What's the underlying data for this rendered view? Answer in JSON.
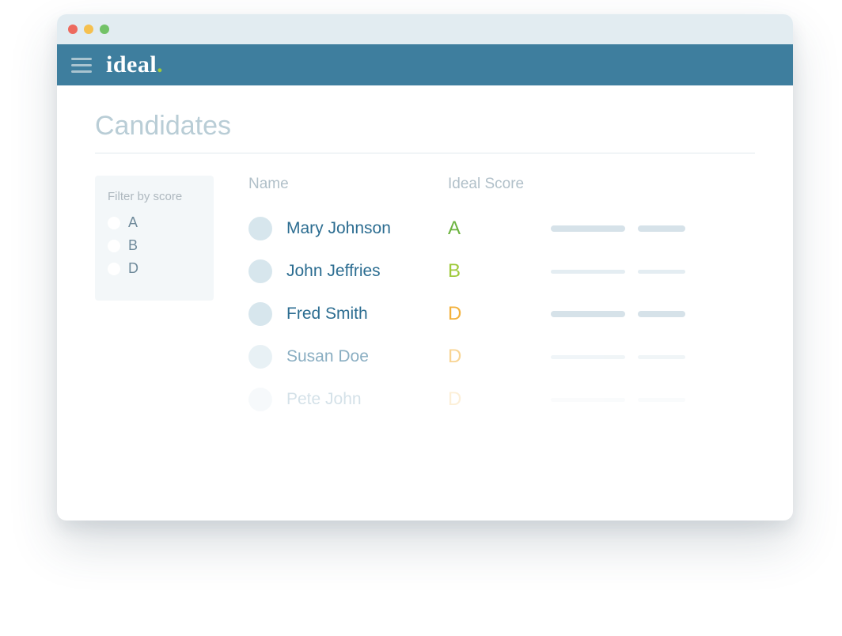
{
  "app": {
    "logo_text": "ideal",
    "logo_dot": "."
  },
  "page": {
    "title": "Candidates"
  },
  "filter": {
    "title": "Filter by score",
    "options": [
      "A",
      "B",
      "D"
    ]
  },
  "columns": {
    "name": "Name",
    "score": "Ideal Score"
  },
  "candidates": [
    {
      "name": "Mary Johnson",
      "score": "A",
      "score_class": "scA",
      "fade": ""
    },
    {
      "name": "John Jeffries",
      "score": "B",
      "score_class": "scB",
      "fade": ""
    },
    {
      "name": "Fred Smith",
      "score": "D",
      "score_class": "scD",
      "fade": ""
    },
    {
      "name": "Susan Doe",
      "score": "D",
      "score_class": "scD",
      "fade": "faded"
    },
    {
      "name": "Pete John",
      "score": "D",
      "score_class": "scD",
      "fade": "faded2"
    }
  ]
}
